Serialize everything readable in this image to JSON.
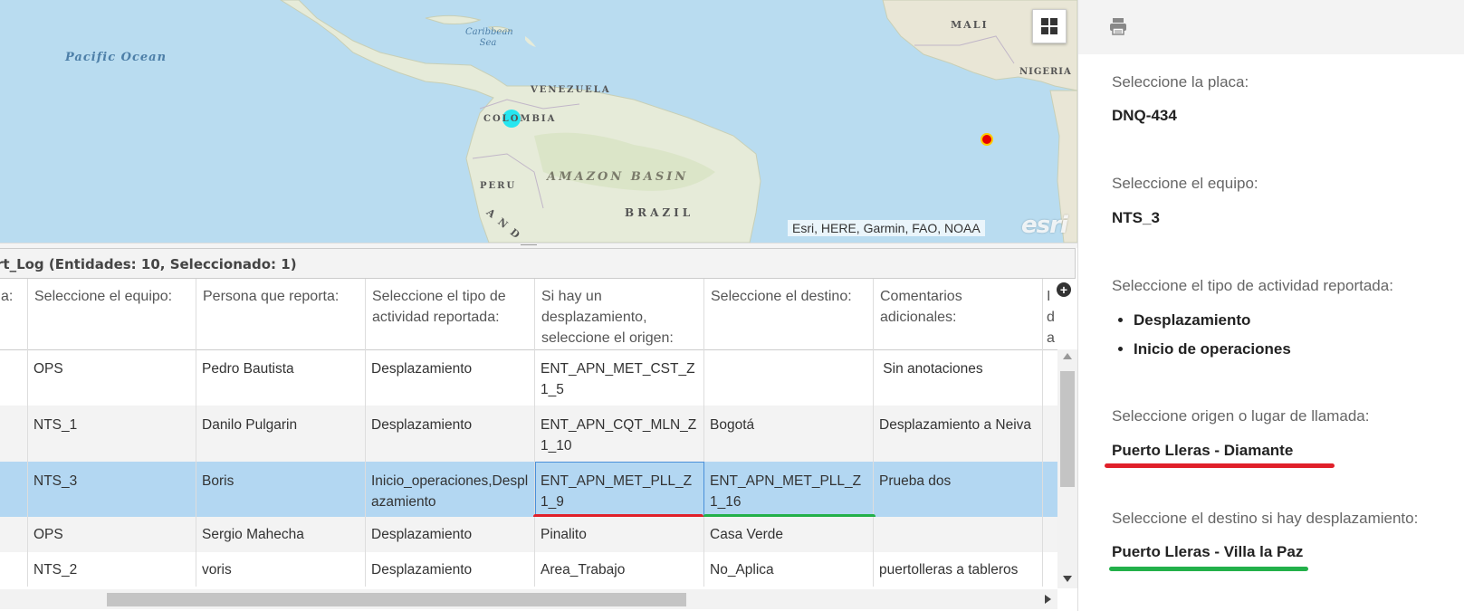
{
  "map": {
    "labels": {
      "pacific": "Pacific Ocean",
      "caribbean": "Caribbean Sea",
      "venezuela": "VENEZUELA",
      "colombia": "COLOMBIA",
      "peru": "PERU",
      "amazon": "AMAZON BASIN",
      "brazil": "BRAZIL",
      "andes": "A N D",
      "mali": "MALI",
      "nigeria": "NIGERIA"
    },
    "attribution": "Esri, HERE, Garmin, FAO, NOAA",
    "logo": "esri",
    "grid_icon": "basemap-gallery-icon",
    "colors": {
      "point_cyan": "#25e6f0",
      "point_red": "#e60000",
      "point_red_outline": "#ffcc00"
    }
  },
  "table": {
    "title": "rt_Log (Entidades: 10, Seleccionado: 1)",
    "columns": [
      "a:",
      "Seleccione el equipo:",
      "Persona que reporta:",
      "Seleccione el tipo de actividad reportada:",
      "Si hay un desplazamiento, seleccione el origen:",
      "Seleccione el destino:",
      "Comentarios adicionales:",
      "I d a"
    ],
    "rows": [
      {
        "equipo": "OPS",
        "persona": "Pedro Bautista",
        "tipo": "Desplazamiento",
        "origen": "ENT_APN_MET_CST_Z1_5",
        "destino": "",
        "comentarios": " Sin anotaciones",
        "selected": false
      },
      {
        "equipo": "NTS_1",
        "persona": "Danilo Pulgarin",
        "tipo": "Desplazamiento",
        "origen": "ENT_APN_CQT_MLN_Z1_10",
        "destino": "Bogotá",
        "comentarios": "Desplazamiento a Neiva",
        "selected": false
      },
      {
        "equipo": "NTS_3",
        "persona": "Boris",
        "tipo": "Inicio_operaciones,Desplazamiento",
        "origen": "ENT_APN_MET_PLL_Z1_9",
        "destino": "ENT_APN_MET_PLL_Z1_16",
        "comentarios": "Prueba dos",
        "selected": true
      },
      {
        "equipo": "OPS",
        "persona": "Sergio Mahecha",
        "tipo": "Desplazamiento",
        "origen": "Pinalito",
        "destino": "Casa Verde",
        "comentarios": "",
        "selected": false
      },
      {
        "equipo": "NTS_2",
        "persona": "voris",
        "tipo": "Desplazamiento",
        "origen": "Area_Trabajo",
        "destino": "No_Aplica",
        "comentarios": "puertolleras a tableros",
        "selected": false
      }
    ],
    "colors": {
      "selected_row": "#b3d7f2",
      "underline_red": "#e0202a",
      "underline_green": "#23b04a"
    }
  },
  "side": {
    "print_icon": "print-icon",
    "placa_label": "Seleccione la placa:",
    "placa_value": "DNQ-434",
    "equipo_label": "Seleccione el equipo:",
    "equipo_value": "NTS_3",
    "tipo_label": "Seleccione el tipo de actividad reportada:",
    "tipo_values": [
      "Desplazamiento",
      "Inicio de operaciones"
    ],
    "origen_label": "Seleccione origen o lugar de llamada:",
    "origen_value": "Puerto Lleras - Diamante",
    "destino_label": "Seleccione el destino si hay desplazamiento:",
    "destino_value": "Puerto Lleras - Villa la Paz"
  }
}
